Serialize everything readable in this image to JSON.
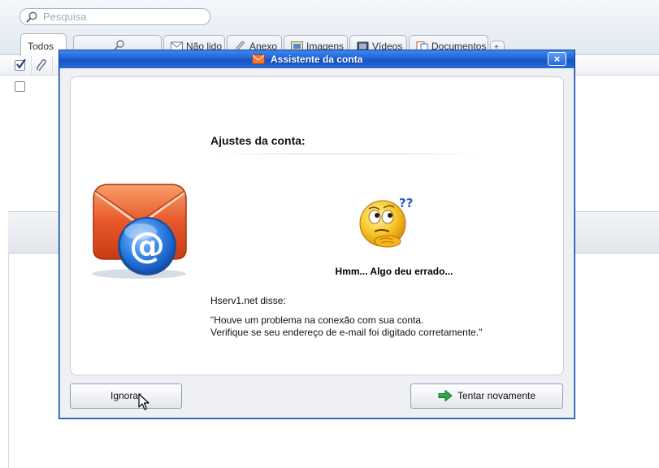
{
  "app": {
    "search": {
      "placeholder": "Pesquisa",
      "value": ""
    },
    "tabs": [
      {
        "label": "Todos",
        "icon": "none"
      },
      {
        "label": "",
        "icon": "search-icon"
      },
      {
        "label": "Não lido",
        "icon": "envelope-icon"
      },
      {
        "label": "Anexo",
        "icon": "paperclip-icon"
      },
      {
        "label": "Imagens",
        "icon": "image-icon"
      },
      {
        "label": "Vídeos",
        "icon": "film-icon"
      },
      {
        "label": "Documentos",
        "icon": "document-icon"
      }
    ],
    "tab_add_label": "+"
  },
  "dialog": {
    "title": "Assistente da conta",
    "close_label": "×",
    "heading": "Ajustes da conta:",
    "error_message": "Hmm... Algo deu errado...",
    "sender": "Hserv1.net disse:",
    "quote_line1": "\"Houve um problema na conexão com sua conta.",
    "quote_line2": "Verifique se seu endereço de e-mail foi digitado corretamente.\"",
    "ignore_label": "Ignorar",
    "retry_label": "Tentar novamente"
  },
  "colors": {
    "titlebar": "#1f62d6",
    "envelope": "#e8572a",
    "at_circle": "#2a7be0",
    "retry_arrow": "#2fa84a",
    "smiley": "#f7c82a"
  }
}
